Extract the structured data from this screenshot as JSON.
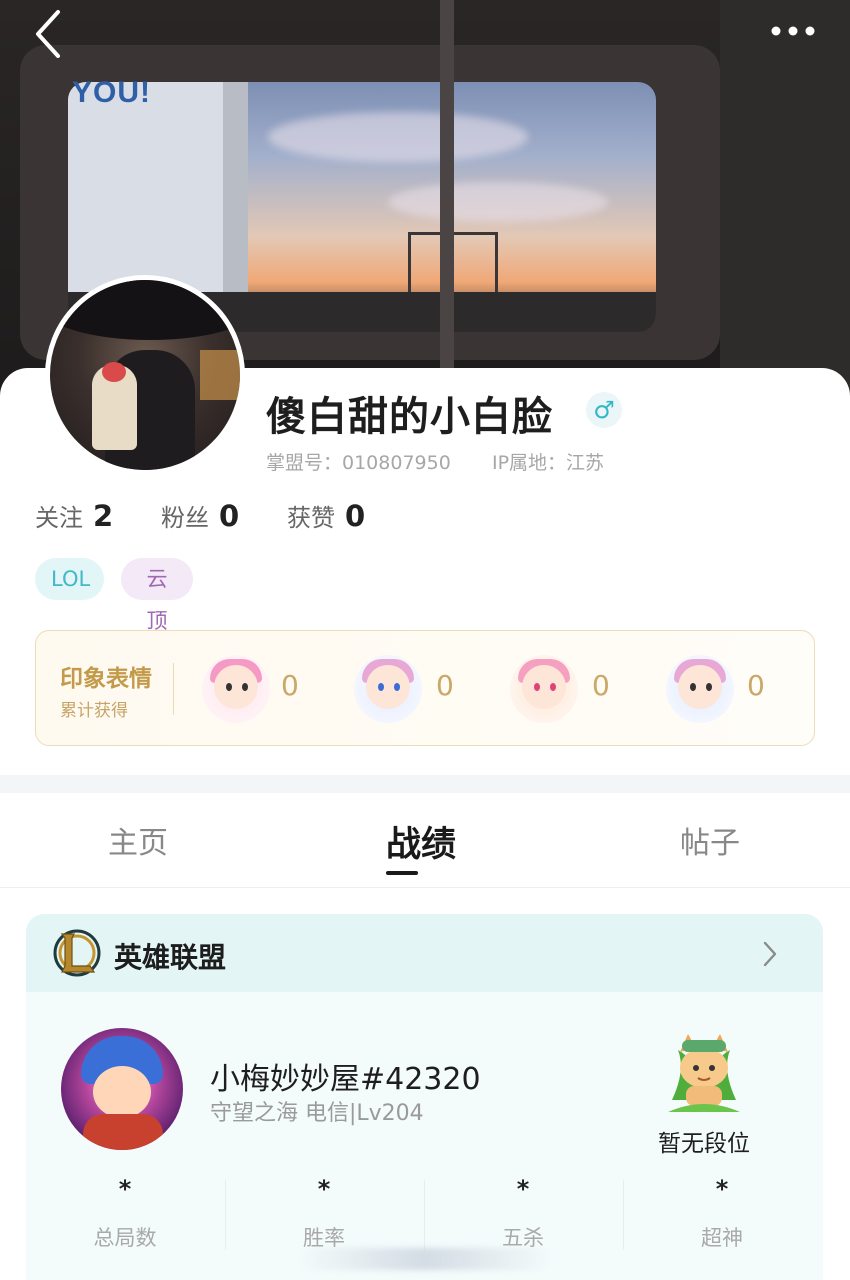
{
  "header": {
    "billboard_text": "YOU!",
    "back_icon": "chevron-left-icon",
    "more_icon": "more-dots-icon"
  },
  "profile": {
    "nickname": "傻白甜的小白脸",
    "gender_symbol": "♂",
    "id_text": "掌盟号：010807950",
    "ip_text": "IP属地：江苏",
    "stats": [
      {
        "label": "关注",
        "value": "2"
      },
      {
        "label": "粉丝",
        "value": "0"
      },
      {
        "label": "获赞",
        "value": "0"
      }
    ],
    "tags": [
      "LOL",
      "云顶"
    ]
  },
  "emotes": {
    "title": "印象表情",
    "subtitle": "累计获得",
    "items": [
      {
        "icon": "cover-face-emote-icon",
        "count": "0"
      },
      {
        "icon": "wave-emote-icon",
        "count": "0"
      },
      {
        "icon": "heart-emote-icon",
        "count": "0"
      },
      {
        "icon": "gg-emote-icon",
        "count": "0"
      }
    ]
  },
  "tabs": [
    {
      "label": "主页",
      "active": false
    },
    {
      "label": "战绩",
      "active": true
    },
    {
      "label": "帖子",
      "active": false
    }
  ],
  "lol": {
    "title": "英雄联盟",
    "summoner": "小梅妙妙屋#42320",
    "server": "守望之海 电信|Lv204",
    "rank": "暂无段位",
    "stats": [
      {
        "label": "总局数",
        "value": "*"
      },
      {
        "label": "胜率",
        "value": "*"
      },
      {
        "label": "五杀",
        "value": "*"
      },
      {
        "label": "超神",
        "value": "*"
      }
    ]
  },
  "colors": {
    "accent_teal": "#43b8c6",
    "accent_purple": "#a06ab3",
    "gold": "#c29a4a"
  }
}
